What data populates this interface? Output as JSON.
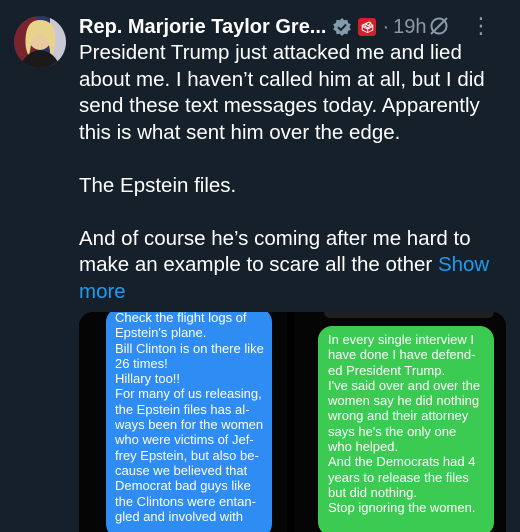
{
  "post": {
    "author_name": "Rep. Marjorie Taylor Gre...",
    "badge_text": "🗳",
    "separator": "·",
    "timestamp": "19h",
    "more_menu": "⋮",
    "paragraphs": [
      [
        "President Trump just attacked me and lied",
        "about me. I haven’t called him at all, but I did",
        "send these text messages today. Apparently",
        "this is what sent him over the edge."
      ],
      [
        "The Epstein files."
      ],
      [
        "And of course he’s coming after me hard to",
        "make an example to scare all the other "
      ]
    ],
    "show_more_part1": "Show",
    "show_more_part2": "more"
  },
  "media": {
    "left_message_lines": [
      "Check the flight logs of",
      "Epstein's plane.",
      "Bill Clinton is on there like",
      "26 times!",
      "Hillary too!!",
      "For many of us releasing,",
      "the Epstein files has al-",
      "ways been for the women",
      "who were victims of Jef-",
      "frey Epstein, but also be-",
      "cause we believed that",
      "Democrat bad guys like",
      "the Clintons were entan-",
      "gled and involved with"
    ],
    "right_message_lines": [
      "In every single interview I",
      "have done I have defend-",
      "ed President Trump.",
      "I've said over and over the",
      "women say he did nothing",
      "wrong and their attorney",
      "says he's the only one",
      "who helped.",
      "And the Democrats had 4",
      "years to release the files",
      "but did nothing.",
      "Stop ignoring the women."
    ]
  },
  "colors": {
    "background": "#15202b",
    "link": "#1d9bf0",
    "sent_bubble": "#2f8cf2",
    "sms_bubble": "#3ccb52",
    "muted": "#8b98a5"
  }
}
